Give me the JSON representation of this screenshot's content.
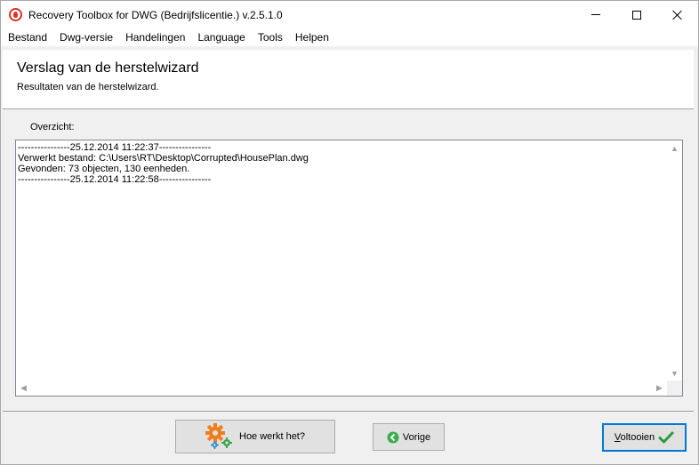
{
  "window": {
    "title": "Recovery Toolbox for DWG (Bedrijfslicentie.) v.2.5.1.0"
  },
  "menu": {
    "items": [
      "Bestand",
      "Dwg-versie",
      "Handelingen",
      "Language",
      "Tools",
      "Helpen"
    ]
  },
  "header": {
    "title": "Verslag van de herstelwizard",
    "subtitle": "Resultaten van de herstelwizard."
  },
  "overview": {
    "label": "Overzicht:",
    "log_lines": [
      "----------------25.12.2014 11:22:37----------------",
      "Verwerkt bestand: C:\\Users\\RT\\Desktop\\Corrupted\\HousePlan.dwg",
      "Gevonden: 73 objecten, 130 eenheden.",
      "----------------25.12.2014 11:22:58----------------"
    ]
  },
  "buttons": {
    "how_label": "Hoe werkt het?",
    "prev_label": "Vorige",
    "finish_label_underlined": "V",
    "finish_label_rest": "oltooien"
  },
  "colors": {
    "gear_orange": "#f07c1a",
    "gear_green": "#3aa84a",
    "gear_blue": "#2a8fd8",
    "check_green": "#2a9a3a",
    "prev_green": "#3aae4a"
  },
  "icons": {
    "app": "recovery-toolbox-icon",
    "how": "gears-icon",
    "prev": "back-arrow-icon",
    "finish": "checkmark-icon"
  }
}
